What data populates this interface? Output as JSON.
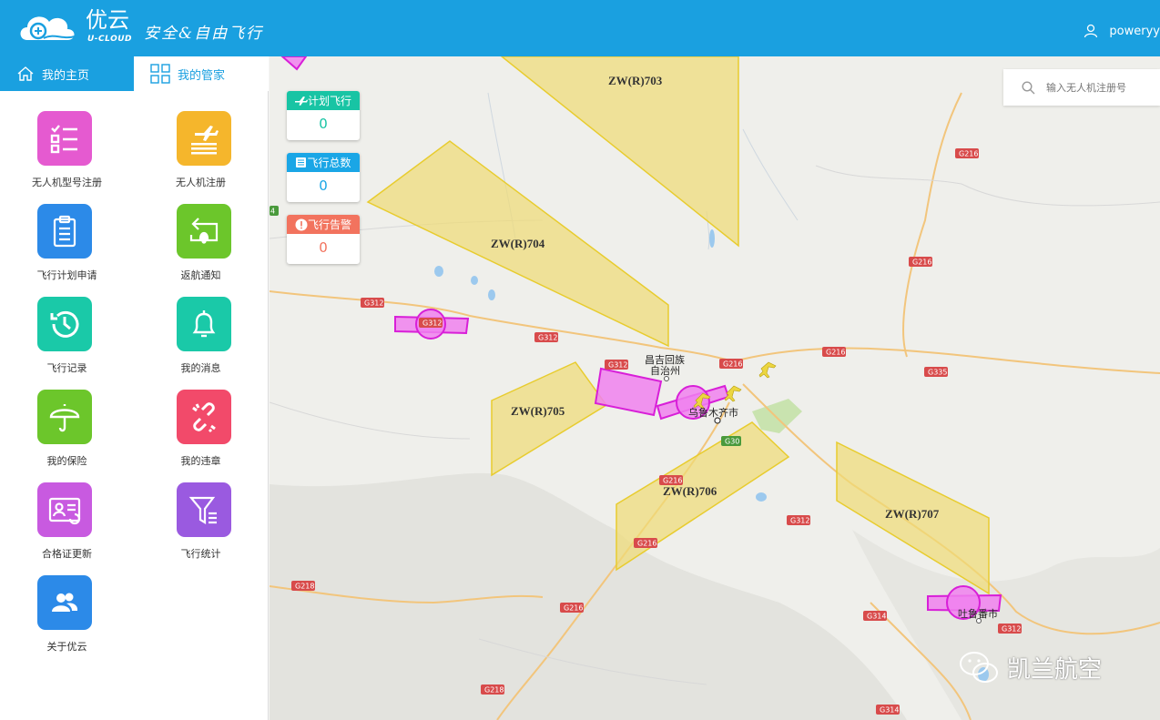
{
  "header": {
    "brand": "优云",
    "brand_sub": "U-CLOUD",
    "slogan": "安全&自由飞行",
    "username": "poweryy"
  },
  "tabs": [
    {
      "label": "我的主页",
      "active": true
    },
    {
      "label": "我的管家",
      "active": false
    }
  ],
  "menu": [
    {
      "label": "无人机型号注册",
      "icon": "checklist-icon",
      "color": "#e55ad0"
    },
    {
      "label": "无人机注册",
      "icon": "plane-list-icon",
      "color": "#f5b62c"
    },
    {
      "label": "飞行计划申请",
      "icon": "clipboard-icon",
      "color": "#2c8ae8"
    },
    {
      "label": "返航通知",
      "icon": "return-bell-icon",
      "color": "#6cc62b"
    },
    {
      "label": "飞行记录",
      "icon": "history-icon",
      "color": "#1ac9a8"
    },
    {
      "label": "我的消息",
      "icon": "bell-icon",
      "color": "#1ac9a8"
    },
    {
      "label": "我的保险",
      "icon": "umbrella-icon",
      "color": "#6cc62b"
    },
    {
      "label": "我的违章",
      "icon": "broken-link-icon",
      "color": "#f24a6a"
    },
    {
      "label": "合格证更新",
      "icon": "id-card-icon",
      "color": "#c85ae0"
    },
    {
      "label": "飞行统计",
      "icon": "filter-stats-icon",
      "color": "#9a5ae0"
    },
    {
      "label": "关于优云",
      "icon": "users-icon",
      "color": "#2c8ae8"
    }
  ],
  "stats": [
    {
      "label": "计划飞行",
      "value": "0",
      "color": "#18c4a4"
    },
    {
      "label": "飞行总数",
      "value": "0",
      "color": "#1aa6e6"
    },
    {
      "label": "飞行告警",
      "value": "0",
      "color": "#f2735e"
    }
  ],
  "search": {
    "placeholder": "输入无人机注册号"
  },
  "map": {
    "zones": [
      "ZW(R)703",
      "ZW(R)704",
      "ZW(R)705",
      "ZW(R)706",
      "ZW(R)707"
    ],
    "roads": [
      "G216",
      "G216",
      "G216",
      "G312",
      "G312",
      "G312",
      "G312",
      "G312",
      "G312",
      "G335",
      "G30",
      "G216",
      "G216",
      "G218",
      "G218",
      "G216",
      "G314",
      "G314",
      "G312",
      "G312"
    ],
    "cities": [
      "昌吉回族",
      "自治州",
      "乌鲁木齐市",
      "吐鲁番市"
    ],
    "edge_badge": "4"
  },
  "watermark": "凯兰航空"
}
